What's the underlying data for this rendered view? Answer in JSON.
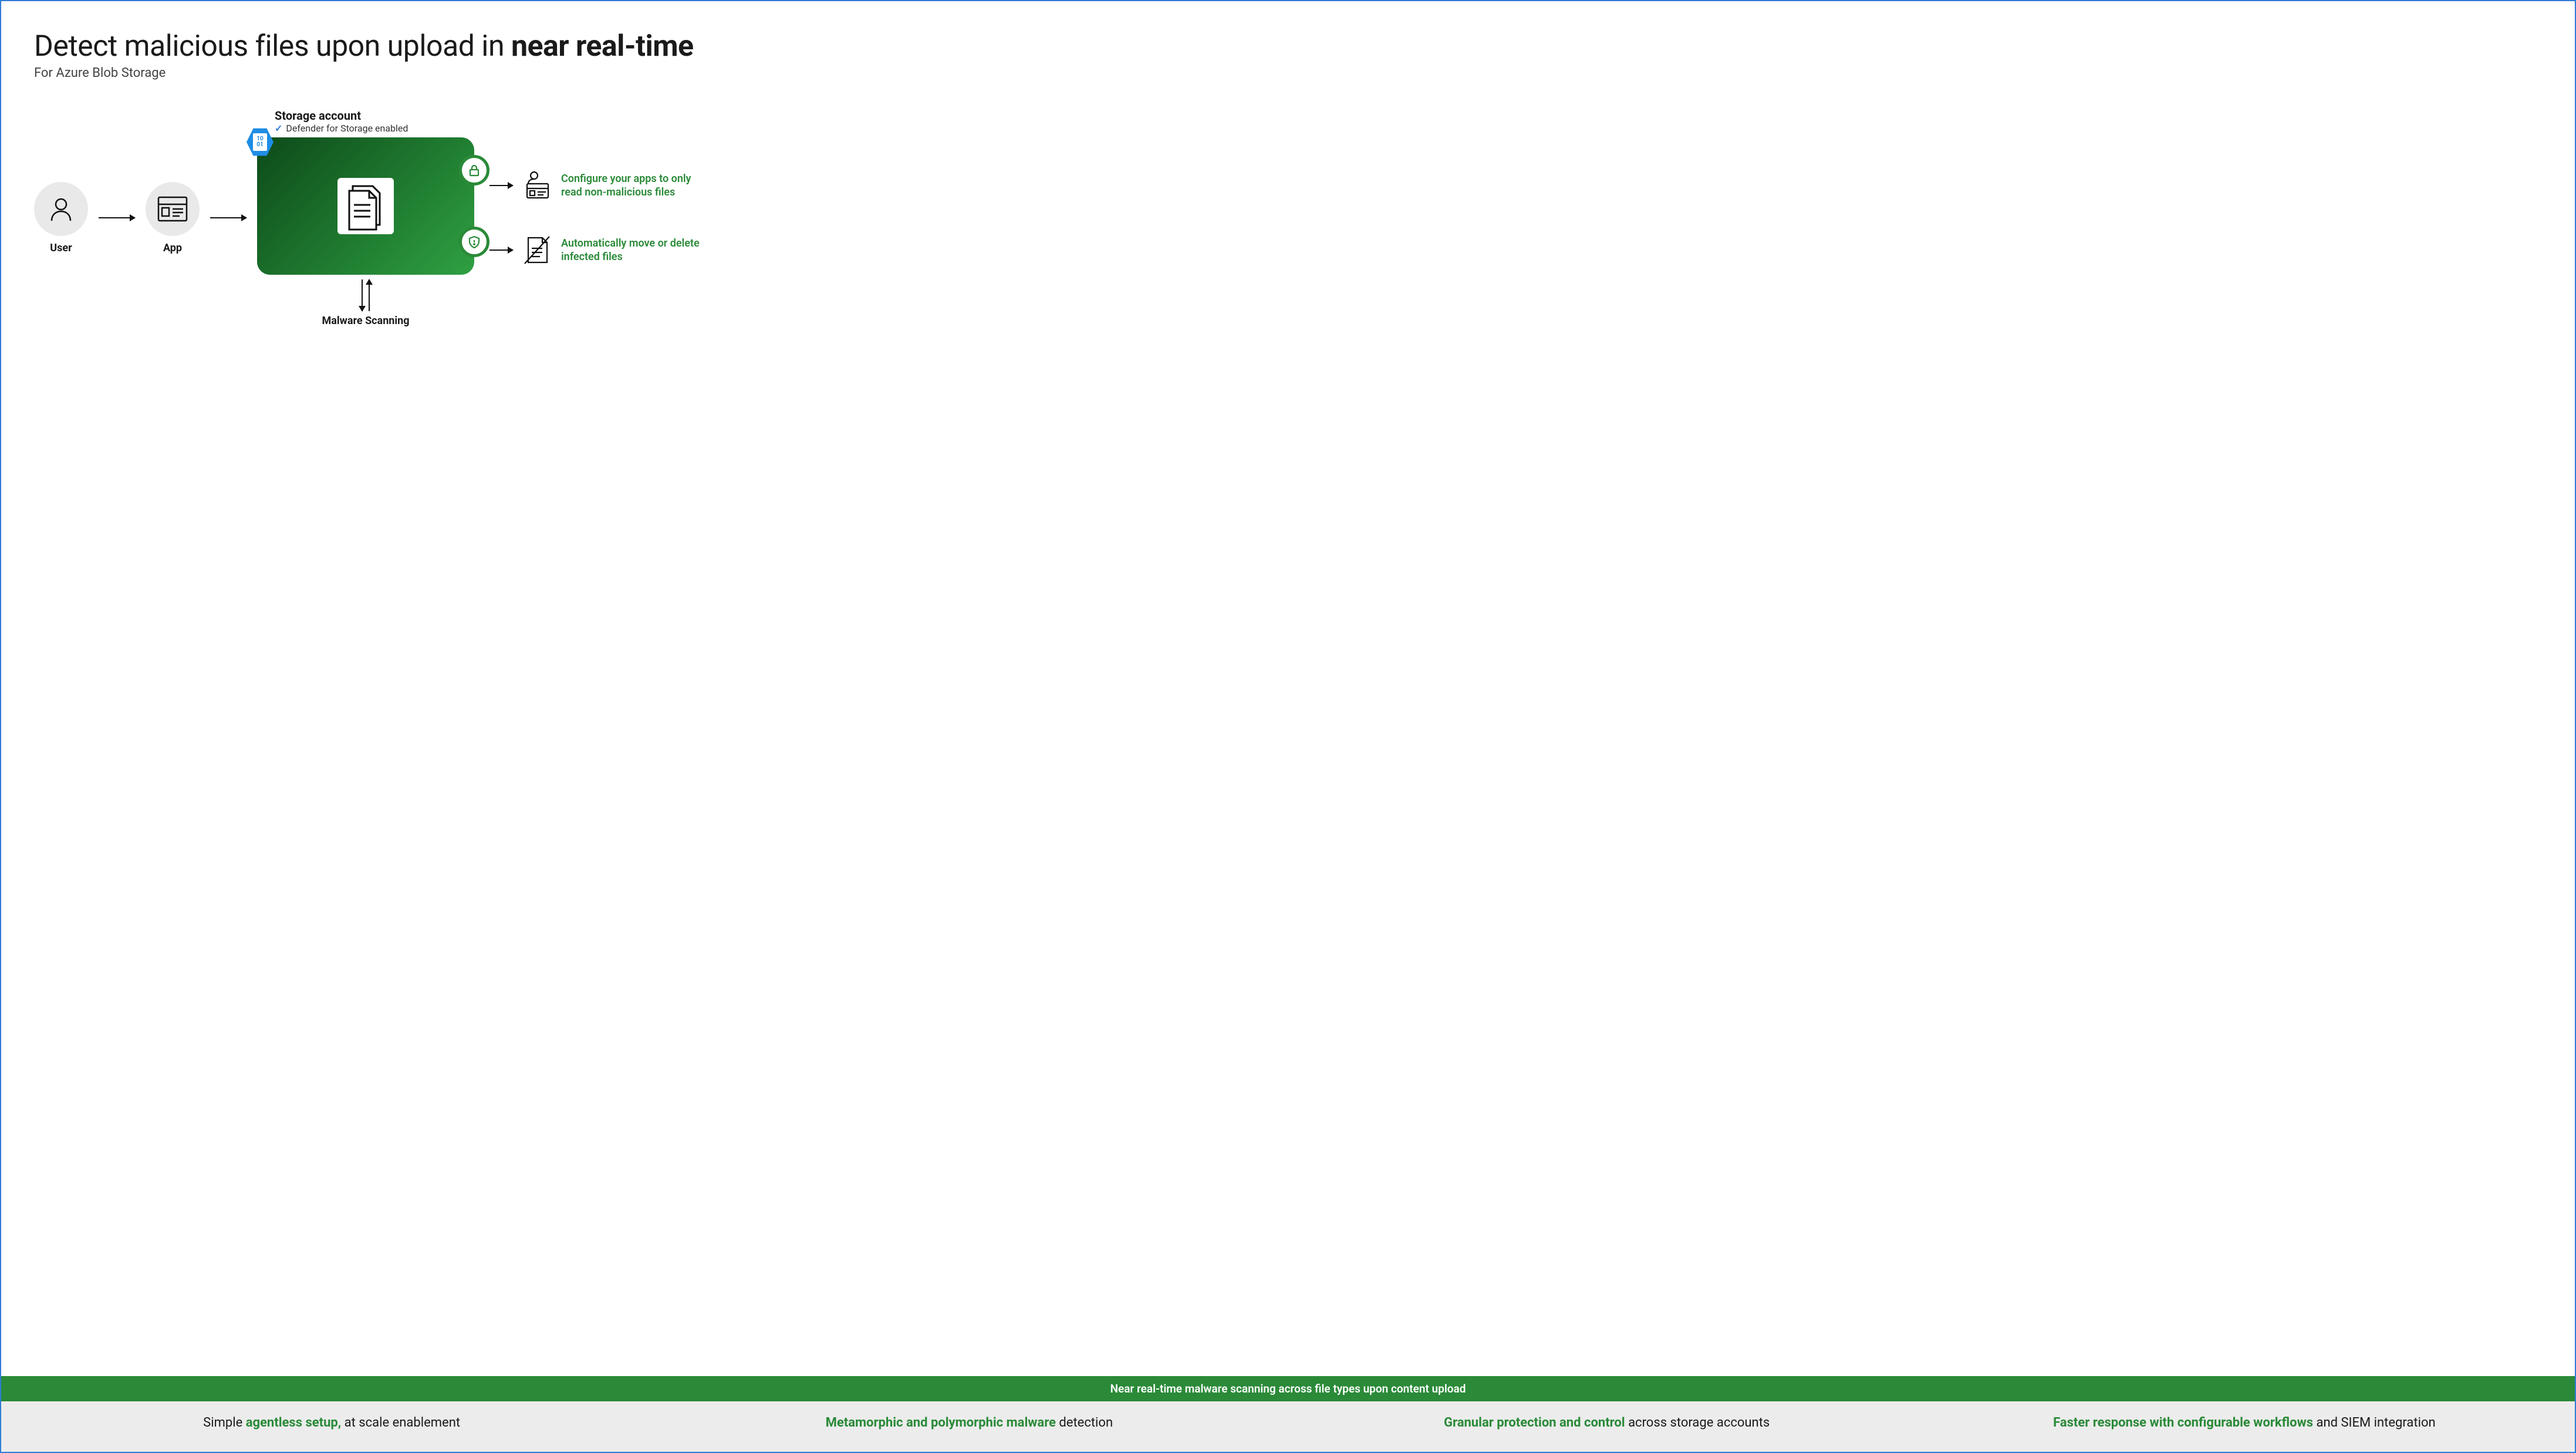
{
  "header": {
    "title_plain": "Detect malicious files upon upload in ",
    "title_bold": "near real-time",
    "subtitle": "For Azure Blob Storage"
  },
  "diagram": {
    "user_label": "User",
    "app_label": "App",
    "storage_title": "Storage account",
    "defender_label": "Defender for Storage enabled",
    "hex_top": "10",
    "hex_bottom": "01",
    "scan_label": "Malware Scanning",
    "output_top": "Configure your apps to only read non-malicious files",
    "output_bottom": "Automatically move or delete infected files"
  },
  "banner": "Near real-time malware scanning across file types upon content upload",
  "features": [
    {
      "pre": "Simple ",
      "hl": "agentless setup,",
      "post": " at scale enablement"
    },
    {
      "pre": "",
      "hl": "Metamorphic and polymorphic malware",
      "post": " detection"
    },
    {
      "pre": "",
      "hl": "Granular protection and control",
      "post": " across storage accounts"
    },
    {
      "pre": "",
      "hl": "Faster response with configurable workflows",
      "post": " and SIEM integration"
    }
  ]
}
